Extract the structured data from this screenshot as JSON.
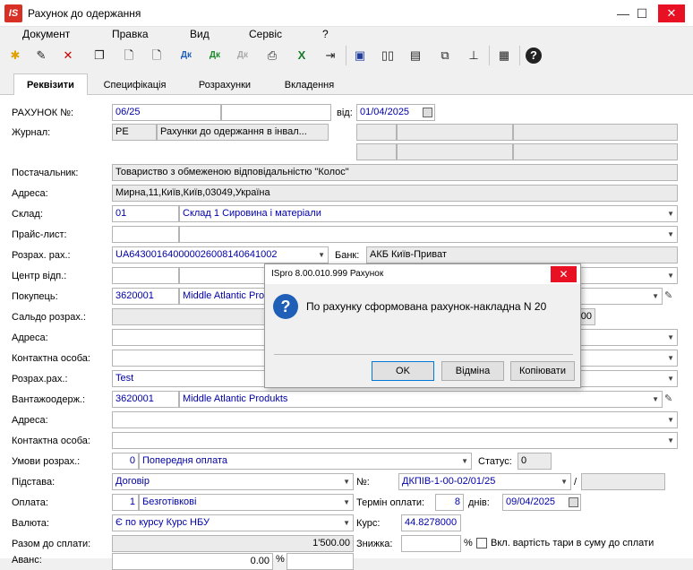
{
  "window": {
    "title": "Рахунок до одержання",
    "logo": "IS",
    "minimize": "—",
    "maximize": "☐",
    "close": "✕"
  },
  "menu": [
    "Документ",
    "Правка",
    "Вид",
    "Сервіс",
    "?"
  ],
  "toolbar_icons": [
    "new-icon",
    "edit-icon",
    "delete-icon",
    "copy-icon",
    "doc-new-icon",
    "doc-add-icon",
    "dk-icon",
    "dk-green-icon",
    "dk-disabled-icon",
    "print-icon",
    "excel-icon",
    "exit-icon",
    "save-icon",
    "book-icon",
    "folder-icon",
    "link-icon",
    "tree-icon",
    "grid-icon",
    "help-icon"
  ],
  "tabs": [
    "Реквізити",
    "Специфікація",
    "Розрахунки",
    "Вкладення"
  ],
  "form": {
    "invoice_no_label": "РАХУНОК №:",
    "invoice_no": "06/25",
    "from_label": "від:",
    "from_date": "01/04/2025",
    "journal_label": "Журнал:",
    "journal_code": "РЕ",
    "journal_name": "Рахунки до одержання в інвал...",
    "supplier_label": "Постачальник:",
    "supplier": "Товариство з обмеженою відповідальністю \"Колос\"",
    "address_label": "Адреса:",
    "address": "Мирна,11,Київ,Київ,03049,Україна",
    "warehouse_label": "Склад:",
    "warehouse_code": "01",
    "warehouse_name": "Склад 1 Сировина і матеріали",
    "pricelist_label": "Прайс-лист:",
    "account_label": "Розрах. рах.:",
    "account": "UA643001640000026008140641002",
    "bank_label": "Банк:",
    "bank": "АКБ Київ-Приват",
    "resp_center_label": "Центр відп.:",
    "buyer_label": "Покупець:",
    "buyer_code": "3620001",
    "buyer_name": "Middle Atlantic Produkts",
    "balance_label": "Сальдо розрах.:",
    "balance_tail": "00",
    "buyer_address_label": "Адреса:",
    "contact_label": "Контактна особа:",
    "buyer_account_label": "Розрах.рах.:",
    "buyer_account": "Test",
    "consignee_label": "Вантажоодерж.:",
    "consignee_code": "3620001",
    "consignee_name": "Middle Atlantic Produkts",
    "consignee_address_label": "Адреса:",
    "consignee_contact_label": "Контактна особа:",
    "terms_label": "Умови розрах.:",
    "terms_code": "0",
    "terms_name": "Попередня оплата",
    "status_label": "Статус:",
    "status": "0",
    "basis_label": "Підстава:",
    "basis": "Договір",
    "no_label": "№:",
    "contract_no": "ДКПІВ-1-00-02/01/25",
    "slash": "/",
    "payment_label": "Оплата:",
    "payment_code": "1",
    "payment_name": "Безготівкові",
    "pay_term_label": "Термін оплати:",
    "pay_term_days": "8",
    "days_label": "днів:",
    "pay_date": "09/04/2025",
    "currency_label": "Валюта:",
    "currency": "Є по курсу Курс НБУ",
    "rate_label": "Курс:",
    "rate": "44.8278000",
    "total_label": "Разом до сплати:",
    "total": "1'500.00",
    "discount_label": "Знижка:",
    "percent": "%",
    "tare_label": "Вкл. вартість тари в суму до сплати",
    "advance_label": "Аванс:",
    "advance": "0.00",
    "advance_pct": "%"
  },
  "dialog": {
    "title": "ISpro 8.00.010.999 Рахунок",
    "close": "✕",
    "message": "По рахунку сформована рахунок-накладна N 20",
    "ok": "OK",
    "cancel": "Відміна",
    "copy": "Копіювати",
    "icon": "question-icon",
    "icon_glyph": "?"
  }
}
